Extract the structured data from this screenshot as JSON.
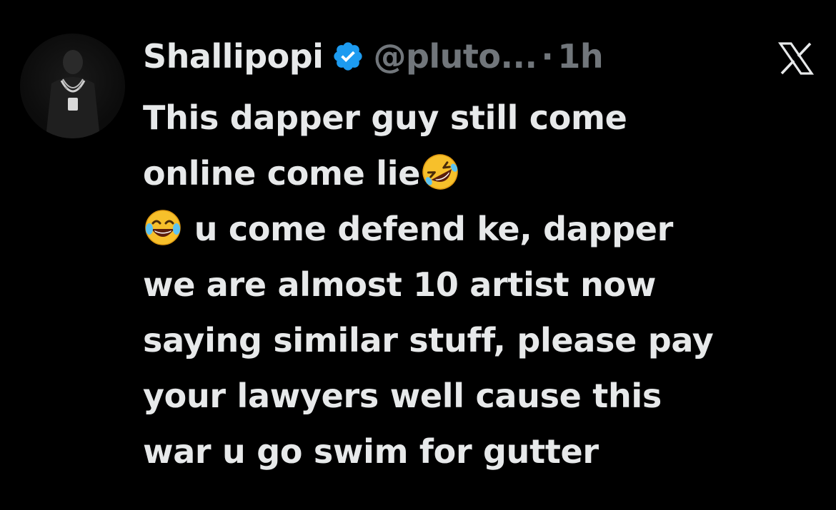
{
  "author": {
    "name": "Shallipopi",
    "handle": "@pluto...",
    "separator": "·",
    "time": "1h",
    "verified": true,
    "verified_color": "#1d9bf0"
  },
  "platform_icon": "x-logo-icon",
  "tweet": {
    "line1": "This dapper guy still come",
    "line2_text": "online come lie",
    "line2_emoji": "rolling-on-floor-laughing-emoji",
    "line3_emoji": "tears-of-joy-emoji",
    "line3_text": " u come defend ke, dapper",
    "line4": "we are almost 10 artist now",
    "line5": "saying similar stuff, please pay",
    "line6": "your lawyers well cause this",
    "line7": "war u go swim for gutter"
  },
  "colors": {
    "background": "#000000",
    "primary_text": "#e7e9ea",
    "secondary_text": "#71767b",
    "accent": "#1d9bf0"
  }
}
